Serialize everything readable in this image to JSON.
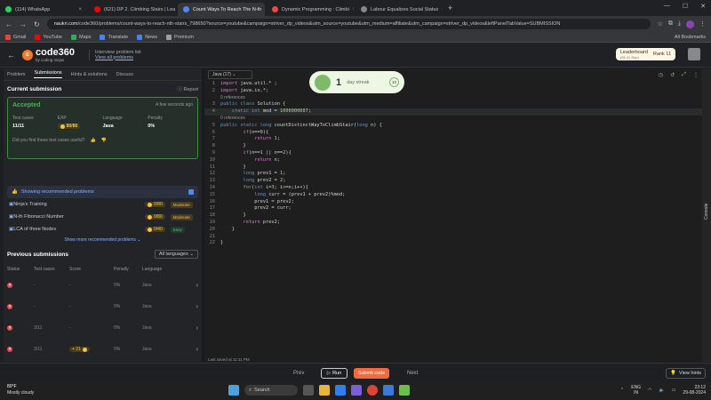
{
  "browser": {
    "tabs": [
      {
        "label": "(114) WhatsApp",
        "color": "#25d366",
        "active": false
      },
      {
        "label": "(621) DP 2. Climbing Stairs | Lea",
        "color": "#ff0000",
        "active": false
      },
      {
        "label": "Count Ways To Reach The N-th",
        "color": "#4a8af4",
        "active": true
      },
      {
        "label": "Dynamic Programming : Climbi",
        "color": "#e74c3c",
        "active": false
      },
      {
        "label": "Labour Equalizes Social Status",
        "color": "#555555",
        "active": false
      }
    ],
    "url_host": "naukri.com",
    "url_path": "/code360/problems/count-ways-to-reach-nth-stairs_798650?source=youtube&campaign=striver_dp_videos&utm_source=youtube&utm_medium=affiliate&utm_campaign=striver_dp_videos&leftPanelTabValue=SUBMISSION",
    "bookmarks": [
      {
        "label": "Gmail",
        "color": "#ea4335"
      },
      {
        "label": "YouTube",
        "color": "#ff0000"
      },
      {
        "label": "Maps",
        "color": "#34a853"
      },
      {
        "label": "Translate",
        "color": "#4285f4"
      },
      {
        "label": "News",
        "color": "#4285f4"
      },
      {
        "label": "Premium",
        "color": "#9aa0a6"
      }
    ],
    "all_bookmarks": "All Bookmarks"
  },
  "header": {
    "logo_text": "code360",
    "logo_sub": "by coding ninjas",
    "problem_list": "Interview problem list",
    "view_all": "View all problems",
    "leaderboard": "Leaderboard",
    "leaderboard_sub": "(28-01 Sep)",
    "rank": "Rank 11"
  },
  "left_tabs": [
    "Problem",
    "Submissions",
    "Hints & solutions",
    "Discuss"
  ],
  "current_submission": {
    "title": "Current submission",
    "report": "Report",
    "status": "Accepted",
    "time": "A few seconds ago",
    "stats": [
      {
        "label": "Test cases",
        "value": "11/11"
      },
      {
        "label": "EXP",
        "value": "80/80"
      },
      {
        "label": "Language",
        "value": "Java"
      },
      {
        "label": "Penalty",
        "value": "0%"
      }
    ],
    "useful": "Did you find these test cases useful?"
  },
  "recommended": {
    "label": "Showing recommended problems",
    "items": [
      {
        "name": "Ninja's Training",
        "exp": "0/80",
        "level": "Moderate"
      },
      {
        "name": "N-th Fibonacci Number",
        "exp": "0/80",
        "level": "Moderate"
      },
      {
        "name": "LCA of three Nodes",
        "exp": "0/40",
        "level": "Easy"
      }
    ],
    "show_more": "Show more recommended problems"
  },
  "previous": {
    "title": "Previous submissions",
    "filter": "All languages",
    "headers": [
      "Status",
      "Test cases",
      "Score",
      "Penalty",
      "Language"
    ],
    "rows": [
      {
        "tests": "-",
        "score": "-",
        "penalty": "0%",
        "lang": "Java"
      },
      {
        "tests": "-",
        "score": "-",
        "penalty": "0%",
        "lang": "Java"
      },
      {
        "tests": "3/11",
        "score": "-",
        "penalty": "0%",
        "lang": "Java"
      },
      {
        "tests": "3/11",
        "score": "+ 21",
        "penalty": "0%",
        "lang": "Java"
      }
    ]
  },
  "editor": {
    "language": "Java (17)",
    "references": "0 references",
    "saved": "Last saved at 11:11 PM",
    "console": "Console"
  },
  "streak": {
    "days": "1",
    "label": "day streak",
    "badge": "10"
  },
  "footer": {
    "prev": "Prev",
    "run": "Run",
    "submit": "Submit code",
    "next": "Next",
    "hints": "View hints"
  },
  "taskbar": {
    "temp": "80°F",
    "weather": "Mostly cloudy",
    "search": "Search",
    "lang1": "ENG",
    "lang2": "IN",
    "time": "23:12",
    "date": "29-08-2024"
  }
}
